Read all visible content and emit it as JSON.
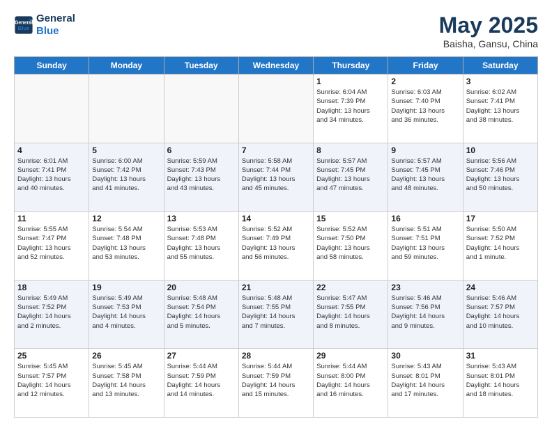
{
  "header": {
    "logo_line1": "General",
    "logo_line2": "Blue",
    "title": "May 2025",
    "subtitle": "Baisha, Gansu, China"
  },
  "days_of_week": [
    "Sunday",
    "Monday",
    "Tuesday",
    "Wednesday",
    "Thursday",
    "Friday",
    "Saturday"
  ],
  "weeks": [
    {
      "days": [
        {
          "num": "",
          "info": ""
        },
        {
          "num": "",
          "info": ""
        },
        {
          "num": "",
          "info": ""
        },
        {
          "num": "",
          "info": ""
        },
        {
          "num": "1",
          "info": "Sunrise: 6:04 AM\nSunset: 7:39 PM\nDaylight: 13 hours\nand 34 minutes."
        },
        {
          "num": "2",
          "info": "Sunrise: 6:03 AM\nSunset: 7:40 PM\nDaylight: 13 hours\nand 36 minutes."
        },
        {
          "num": "3",
          "info": "Sunrise: 6:02 AM\nSunset: 7:41 PM\nDaylight: 13 hours\nand 38 minutes."
        }
      ]
    },
    {
      "days": [
        {
          "num": "4",
          "info": "Sunrise: 6:01 AM\nSunset: 7:41 PM\nDaylight: 13 hours\nand 40 minutes."
        },
        {
          "num": "5",
          "info": "Sunrise: 6:00 AM\nSunset: 7:42 PM\nDaylight: 13 hours\nand 41 minutes."
        },
        {
          "num": "6",
          "info": "Sunrise: 5:59 AM\nSunset: 7:43 PM\nDaylight: 13 hours\nand 43 minutes."
        },
        {
          "num": "7",
          "info": "Sunrise: 5:58 AM\nSunset: 7:44 PM\nDaylight: 13 hours\nand 45 minutes."
        },
        {
          "num": "8",
          "info": "Sunrise: 5:57 AM\nSunset: 7:45 PM\nDaylight: 13 hours\nand 47 minutes."
        },
        {
          "num": "9",
          "info": "Sunrise: 5:57 AM\nSunset: 7:45 PM\nDaylight: 13 hours\nand 48 minutes."
        },
        {
          "num": "10",
          "info": "Sunrise: 5:56 AM\nSunset: 7:46 PM\nDaylight: 13 hours\nand 50 minutes."
        }
      ]
    },
    {
      "days": [
        {
          "num": "11",
          "info": "Sunrise: 5:55 AM\nSunset: 7:47 PM\nDaylight: 13 hours\nand 52 minutes."
        },
        {
          "num": "12",
          "info": "Sunrise: 5:54 AM\nSunset: 7:48 PM\nDaylight: 13 hours\nand 53 minutes."
        },
        {
          "num": "13",
          "info": "Sunrise: 5:53 AM\nSunset: 7:48 PM\nDaylight: 13 hours\nand 55 minutes."
        },
        {
          "num": "14",
          "info": "Sunrise: 5:52 AM\nSunset: 7:49 PM\nDaylight: 13 hours\nand 56 minutes."
        },
        {
          "num": "15",
          "info": "Sunrise: 5:52 AM\nSunset: 7:50 PM\nDaylight: 13 hours\nand 58 minutes."
        },
        {
          "num": "16",
          "info": "Sunrise: 5:51 AM\nSunset: 7:51 PM\nDaylight: 13 hours\nand 59 minutes."
        },
        {
          "num": "17",
          "info": "Sunrise: 5:50 AM\nSunset: 7:52 PM\nDaylight: 14 hours\nand 1 minute."
        }
      ]
    },
    {
      "days": [
        {
          "num": "18",
          "info": "Sunrise: 5:49 AM\nSunset: 7:52 PM\nDaylight: 14 hours\nand 2 minutes."
        },
        {
          "num": "19",
          "info": "Sunrise: 5:49 AM\nSunset: 7:53 PM\nDaylight: 14 hours\nand 4 minutes."
        },
        {
          "num": "20",
          "info": "Sunrise: 5:48 AM\nSunset: 7:54 PM\nDaylight: 14 hours\nand 5 minutes."
        },
        {
          "num": "21",
          "info": "Sunrise: 5:48 AM\nSunset: 7:55 PM\nDaylight: 14 hours\nand 7 minutes."
        },
        {
          "num": "22",
          "info": "Sunrise: 5:47 AM\nSunset: 7:55 PM\nDaylight: 14 hours\nand 8 minutes."
        },
        {
          "num": "23",
          "info": "Sunrise: 5:46 AM\nSunset: 7:56 PM\nDaylight: 14 hours\nand 9 minutes."
        },
        {
          "num": "24",
          "info": "Sunrise: 5:46 AM\nSunset: 7:57 PM\nDaylight: 14 hours\nand 10 minutes."
        }
      ]
    },
    {
      "days": [
        {
          "num": "25",
          "info": "Sunrise: 5:45 AM\nSunset: 7:57 PM\nDaylight: 14 hours\nand 12 minutes."
        },
        {
          "num": "26",
          "info": "Sunrise: 5:45 AM\nSunset: 7:58 PM\nDaylight: 14 hours\nand 13 minutes."
        },
        {
          "num": "27",
          "info": "Sunrise: 5:44 AM\nSunset: 7:59 PM\nDaylight: 14 hours\nand 14 minutes."
        },
        {
          "num": "28",
          "info": "Sunrise: 5:44 AM\nSunset: 7:59 PM\nDaylight: 14 hours\nand 15 minutes."
        },
        {
          "num": "29",
          "info": "Sunrise: 5:44 AM\nSunset: 8:00 PM\nDaylight: 14 hours\nand 16 minutes."
        },
        {
          "num": "30",
          "info": "Sunrise: 5:43 AM\nSunset: 8:01 PM\nDaylight: 14 hours\nand 17 minutes."
        },
        {
          "num": "31",
          "info": "Sunrise: 5:43 AM\nSunset: 8:01 PM\nDaylight: 14 hours\nand 18 minutes."
        }
      ]
    }
  ]
}
